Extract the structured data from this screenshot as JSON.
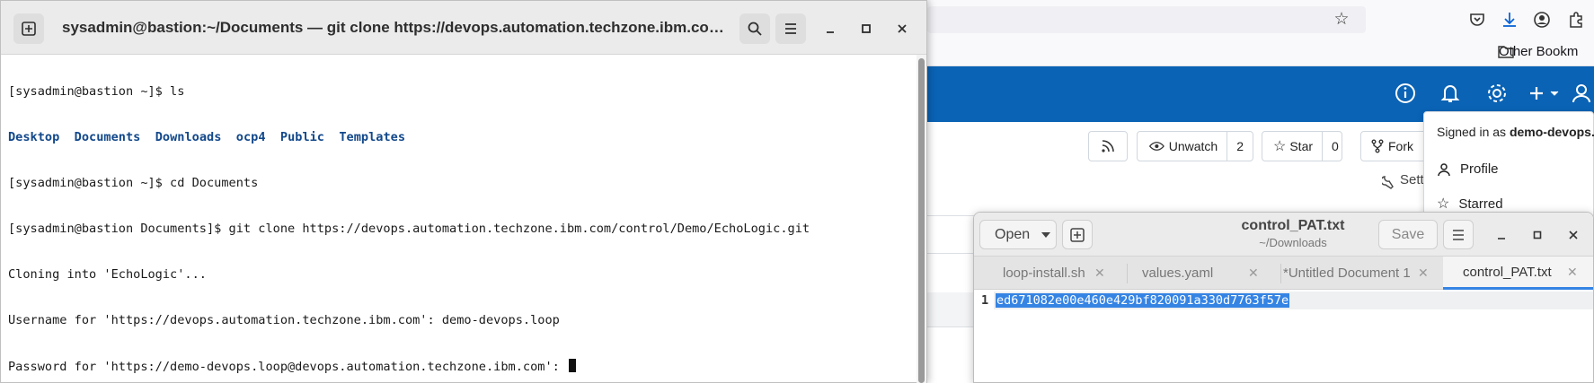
{
  "browser": {
    "other_bookmarks": "Other Bookm",
    "settings_partial": "Sett",
    "repo_buttons": {
      "unwatch_label": "Unwatch",
      "unwatch_count": "2",
      "star_label": "Star",
      "star_count": "0",
      "fork_label": "Fork"
    },
    "user_menu": {
      "signed_in_prefix": "Signed in as ",
      "username": "demo-devops.loo",
      "profile": "Profile",
      "starred": "Starred"
    },
    "colors": {
      "header": "#0a63b5"
    }
  },
  "terminal": {
    "title": "sysadmin@bastion:~/Documents — git clone https://devops.automation.techzone.ibm.com/control/Dem...",
    "prompt_ls": "[sysadmin@bastion ~]$ ls",
    "dirs": [
      "Desktop",
      "Documents",
      "Downloads",
      "ocp4",
      "Public",
      "Templates"
    ],
    "cmd_cd": "[sysadmin@bastion ~]$ cd Documents",
    "cmd_clone": "[sysadmin@bastion Documents]$ git clone https://devops.automation.techzone.ibm.com/control/Demo/EchoLogic.git",
    "out_cloning": "Cloning into 'EchoLogic'...",
    "out_username": "Username for 'https://devops.automation.techzone.ibm.com': demo-devops.loop",
    "out_password": "Password for 'https://demo-devops.loop@devops.automation.techzone.ibm.com': "
  },
  "editor": {
    "open_label": "Open",
    "title": "control_PAT.txt",
    "subtitle": "~/Downloads",
    "save_label": "Save",
    "tabs": [
      {
        "label": "loop-install.sh"
      },
      {
        "label": "values.yaml"
      },
      {
        "label": "*Untitled Document 1"
      },
      {
        "label": "control_PAT.txt"
      }
    ],
    "line_number": "1",
    "content": "ed671082e00e460e429bf820091a330d7763f57e"
  }
}
